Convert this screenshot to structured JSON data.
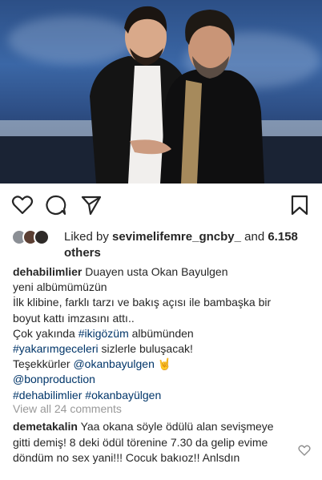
{
  "actions": {
    "like_icon": "heart-outline-icon",
    "comment_icon": "comment-bubble-icon",
    "share_icon": "paper-plane-icon",
    "save_icon": "bookmark-icon"
  },
  "likes": {
    "prefix": "Liked by ",
    "user": "sevimelifemre_gncby_",
    "middle": " and ",
    "count": "6.158",
    "suffix": " others"
  },
  "caption": {
    "username": "dehabilimlier",
    "line1": "Duayen usta Okan Bayulgen",
    "line2": "yeni albümümüzün",
    "line3": "İlk klibine, farklı tarzı ve bakış açısı ile bambaşka bir",
    "line4": "boyut kattı imzasını attı..",
    "line5_pre": "Çok yakında ",
    "line5_tag": "#ikigözüm",
    "line5_post": " albümünden",
    "line6_tag": "#yakarımgeceleri",
    "line6_post": " sizlerle buluşacak!",
    "line7_pre": "Teşekkürler ",
    "line7_tag": "@okanbayulgen",
    "line7_emoji": "🤘",
    "line8_tag": "@bonproduction",
    "line9_tag1": "#dehabilimlier",
    "line9_tag2": "#okanbayülgen"
  },
  "view_all": "View all 24 comments",
  "comment": {
    "username": "demetakalin",
    "text": "Yaa okana söyle ödülü alan sevişmeye gitti demiş! 8 deki ödül törenine 7.30 da gelip evime döndüm no sex yani!!! Cocuk bakıoz!! Anlsdın"
  }
}
